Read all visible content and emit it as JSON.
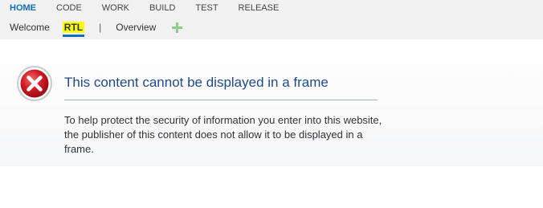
{
  "main_nav": {
    "items": [
      {
        "label": "HOME",
        "active": true
      },
      {
        "label": "CODE",
        "active": false
      },
      {
        "label": "WORK",
        "active": false
      },
      {
        "label": "BUILD",
        "active": false
      },
      {
        "label": "TEST",
        "active": false
      },
      {
        "label": "RELEASE",
        "active": false
      }
    ]
  },
  "sub_nav": {
    "items": [
      {
        "label": "Welcome"
      },
      {
        "label": "RTL",
        "selected": true,
        "highlight": "#ffff00"
      },
      {
        "label": "Overview"
      }
    ],
    "separator": "|",
    "add_icon": "plus-icon"
  },
  "error_frame": {
    "icon": "error-x-icon",
    "title": "This content cannot be displayed in a frame",
    "message": "To help protect the security of information you enter into this website, the publisher of this content does not allow it to be displayed in a frame."
  },
  "colors": {
    "accent": "#106ebe",
    "title": "#1f4a8a",
    "error_red": "#c8121e",
    "add_green": "#8fcd8f",
    "topbar_bg": "#f1f1f1"
  }
}
